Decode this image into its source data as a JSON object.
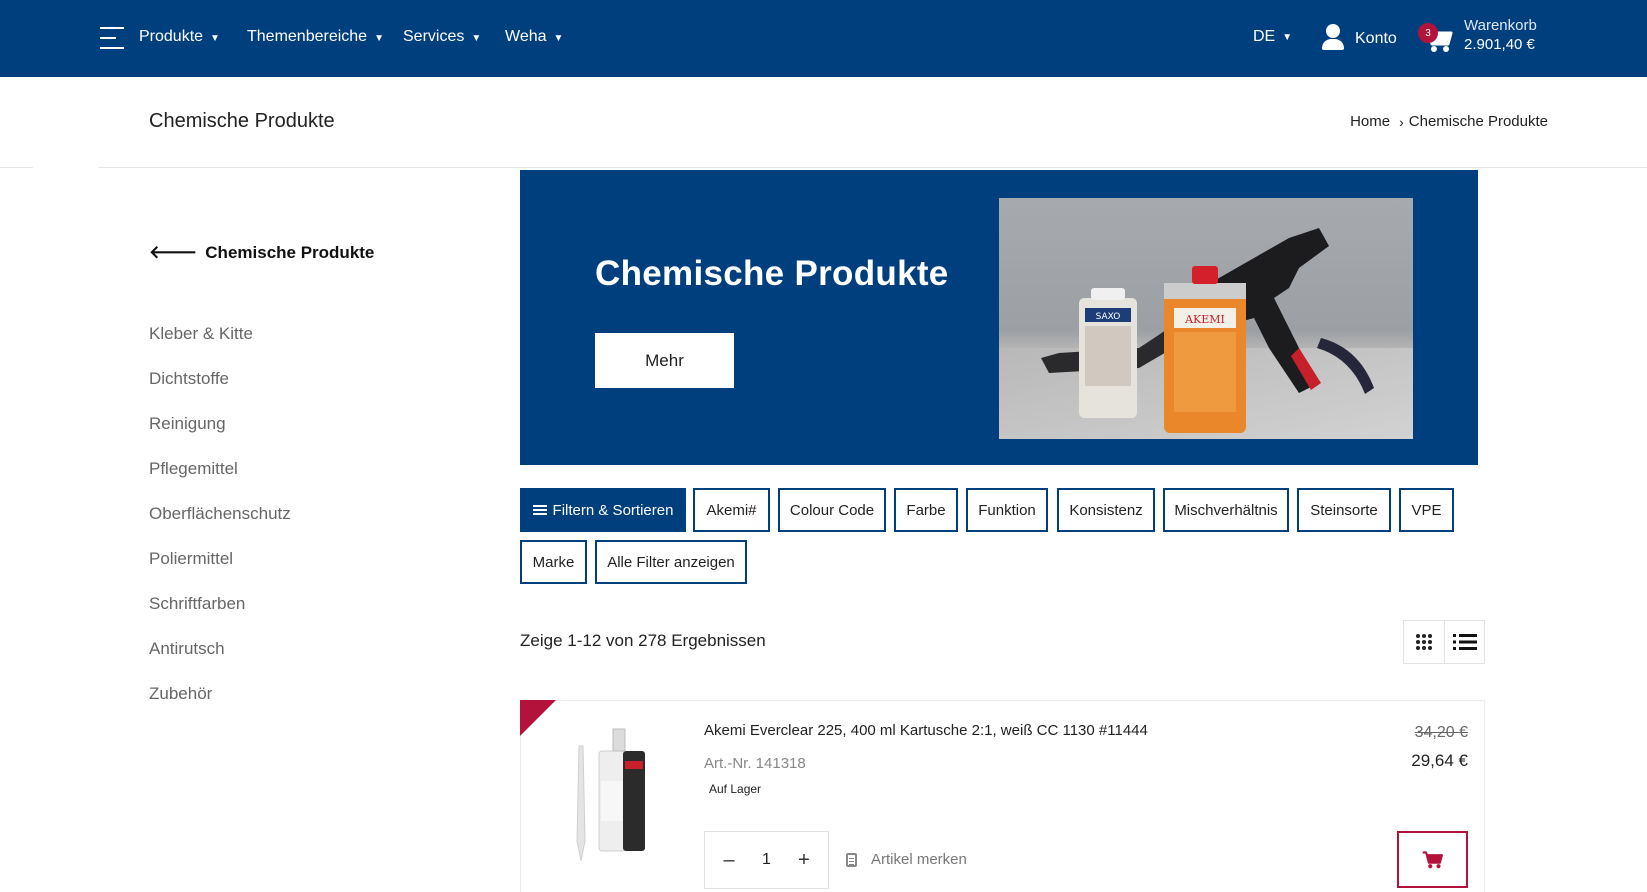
{
  "nav": {
    "items": [
      {
        "label": "Produkte"
      },
      {
        "label": "Themenbereiche"
      },
      {
        "label": "Services"
      },
      {
        "label": "Weha"
      }
    ],
    "language": "DE",
    "account_label": "Konto",
    "cart": {
      "label": "Warenkorb",
      "total": "2.901,40 €",
      "count": "3"
    }
  },
  "page": {
    "title": "Chemische Produkte",
    "breadcrumb": {
      "home": "Home",
      "separator": "›",
      "current": "Chemische Produkte"
    }
  },
  "sidebar": {
    "back_label": "Chemische Produkte",
    "items": [
      {
        "label": "Kleber & Kitte"
      },
      {
        "label": "Dichtstoffe"
      },
      {
        "label": "Reinigung"
      },
      {
        "label": "Pflegemittel"
      },
      {
        "label": "Oberflächenschutz"
      },
      {
        "label": "Poliermittel"
      },
      {
        "label": "Schriftfarben"
      },
      {
        "label": "Antirutsch"
      },
      {
        "label": "Zubehör"
      }
    ]
  },
  "banner": {
    "title": "Chemische Produkte",
    "button_label": "Mehr",
    "photo_labels": {
      "can_small": "SAXO",
      "can_large": "AKEMI"
    }
  },
  "filters": {
    "primary_label": "Filtern & Sortieren",
    "items": [
      {
        "label": "Akemi#"
      },
      {
        "label": "Colour Code"
      },
      {
        "label": "Farbe"
      },
      {
        "label": "Funktion"
      },
      {
        "label": "Konsistenz"
      },
      {
        "label": "Mischverhältnis"
      },
      {
        "label": "Steinsorte"
      },
      {
        "label": "VPE"
      },
      {
        "label": "Marke"
      },
      {
        "label": "Alle Filter anzeigen"
      }
    ]
  },
  "results": {
    "summary": "Zeige 1-12 von 278 Ergebnissen"
  },
  "product": {
    "name": "Akemi Everclear 225, 400 ml Kartusche 2:1, weiß CC 1130 #11444",
    "article_number": "Art.-Nr. 141318",
    "stock": "Auf Lager",
    "old_price": "34,20 €",
    "price": "29,64 €",
    "quantity": "1",
    "qty_minus": "–",
    "qty_plus": "+",
    "bookmark_label": "Artikel merken"
  },
  "colors": {
    "brand_blue": "#003f7d",
    "accent_red": "#b3123a"
  }
}
